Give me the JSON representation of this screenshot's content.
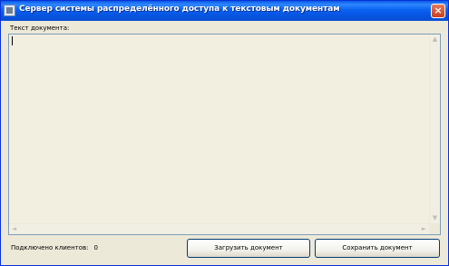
{
  "window": {
    "title": "Сервер системы распределённого доступа к текстовым документам",
    "close_glyph": "×"
  },
  "document": {
    "label": "Текст документа:",
    "content": ""
  },
  "scrollbars": {
    "up": "▲",
    "down": "▼",
    "left": "◄",
    "right": "►"
  },
  "status": {
    "clients_label": "Подключено клиентов:",
    "clients_count": "0"
  },
  "buttons": {
    "load": "Загрузить документ",
    "save": "Сохранить документ"
  }
}
